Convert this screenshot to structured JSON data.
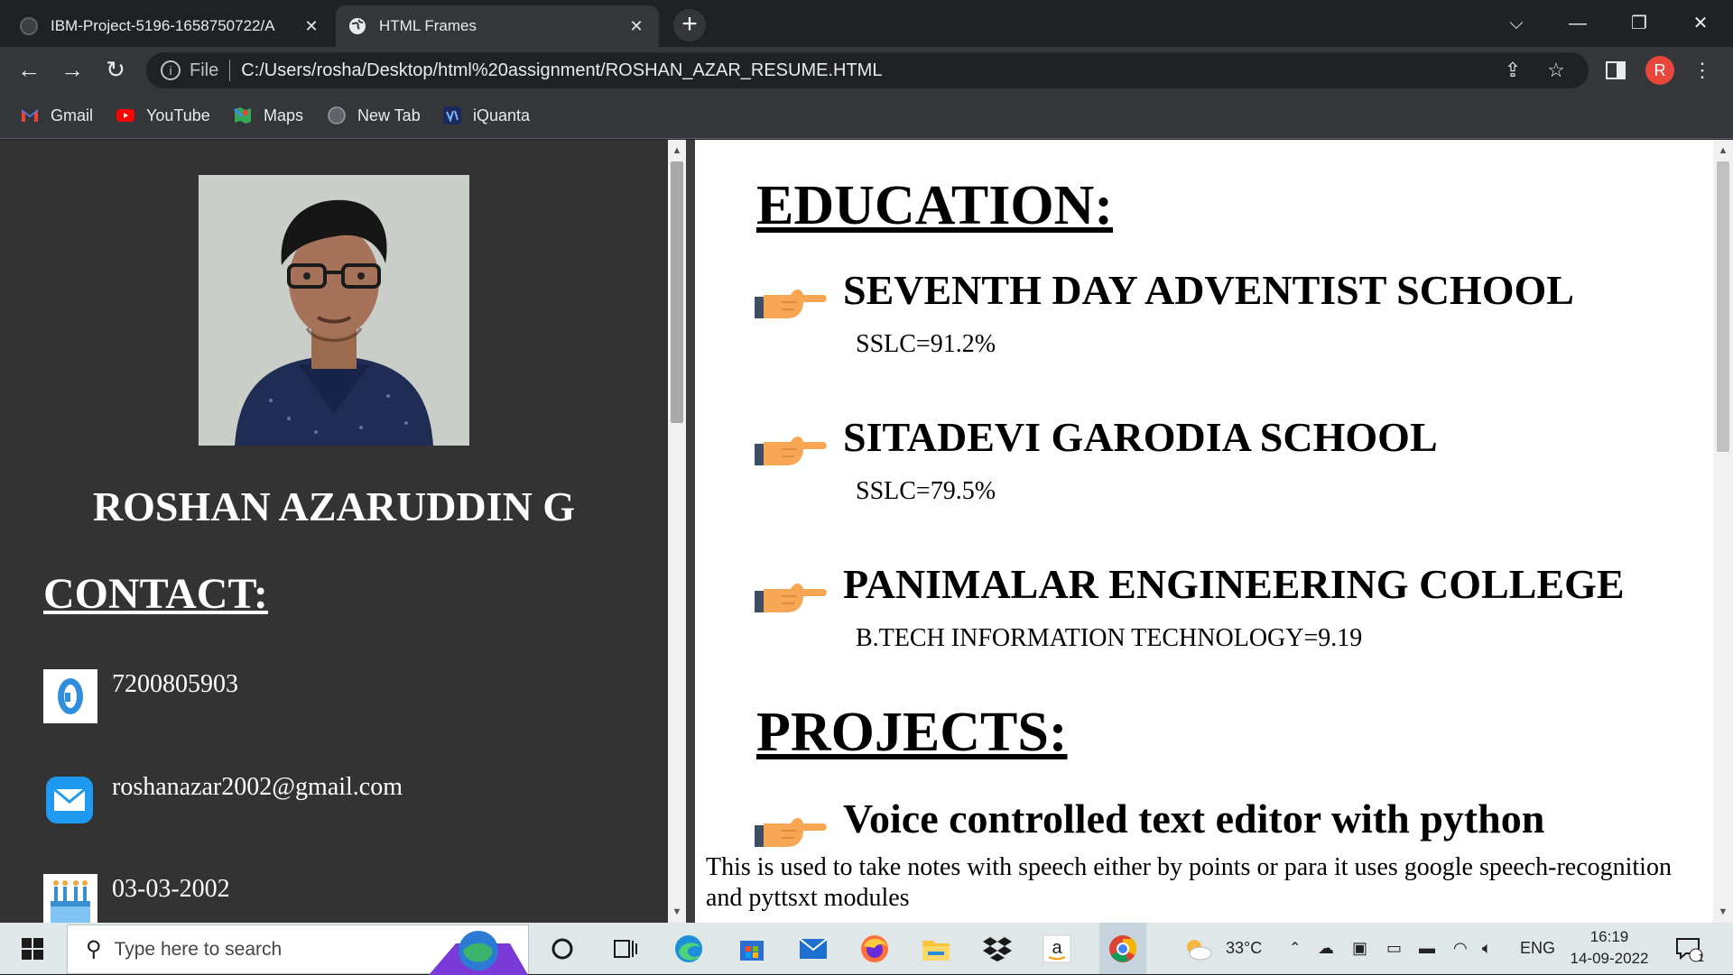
{
  "browser": {
    "tabs": [
      {
        "title": "IBM-Project-5196-1658750722/A",
        "active": false
      },
      {
        "title": "HTML Frames",
        "active": true
      }
    ],
    "address": {
      "scheme": "File",
      "url": "C:/Users/rosha/Desktop/html%20assignment/ROSHAN_AZAR_RESUME.HTML"
    },
    "profile_initial": "R",
    "bookmarks": [
      {
        "label": "Gmail",
        "icon": "gmail-icon"
      },
      {
        "label": "YouTube",
        "icon": "youtube-icon"
      },
      {
        "label": "Maps",
        "icon": "maps-icon"
      },
      {
        "label": "New Tab",
        "icon": "globe-icon"
      },
      {
        "label": "iQuanta",
        "icon": "iquanta-icon"
      }
    ]
  },
  "resume": {
    "name": "ROSHAN AZARUDDIN G",
    "contact_title": "CONTACT:",
    "contacts": [
      {
        "icon": "phone-icon",
        "text": "7200805903"
      },
      {
        "icon": "mail-icon",
        "text": "roshanazar2002@gmail.com"
      },
      {
        "icon": "birthday-cake-icon",
        "text": "03-03-2002"
      }
    ],
    "education_title": "EDUCATION:",
    "education": [
      {
        "school": "SEVENTH DAY ADVENTIST SCHOOL",
        "detail": "SSLC=91.2%"
      },
      {
        "school": "SITADEVI GARODIA SCHOOL",
        "detail": "SSLC=79.5%"
      },
      {
        "school": "PANIMALAR ENGINEERING COLLEGE",
        "detail": "B.TECH INFORMATION TECHNOLOGY=9.19"
      }
    ],
    "projects_title": "PROJECTS:",
    "projects": [
      {
        "title": "Voice controlled text editor with python",
        "description": "This is used to take notes with speech either by points or para it uses google speech-recognition and pyttsxt modules"
      }
    ]
  },
  "taskbar": {
    "search_placeholder": "Type here to search",
    "weather": "33°C",
    "language": "ENG",
    "time": "16:19",
    "date": "14-09-2022",
    "notification_count": "1"
  }
}
